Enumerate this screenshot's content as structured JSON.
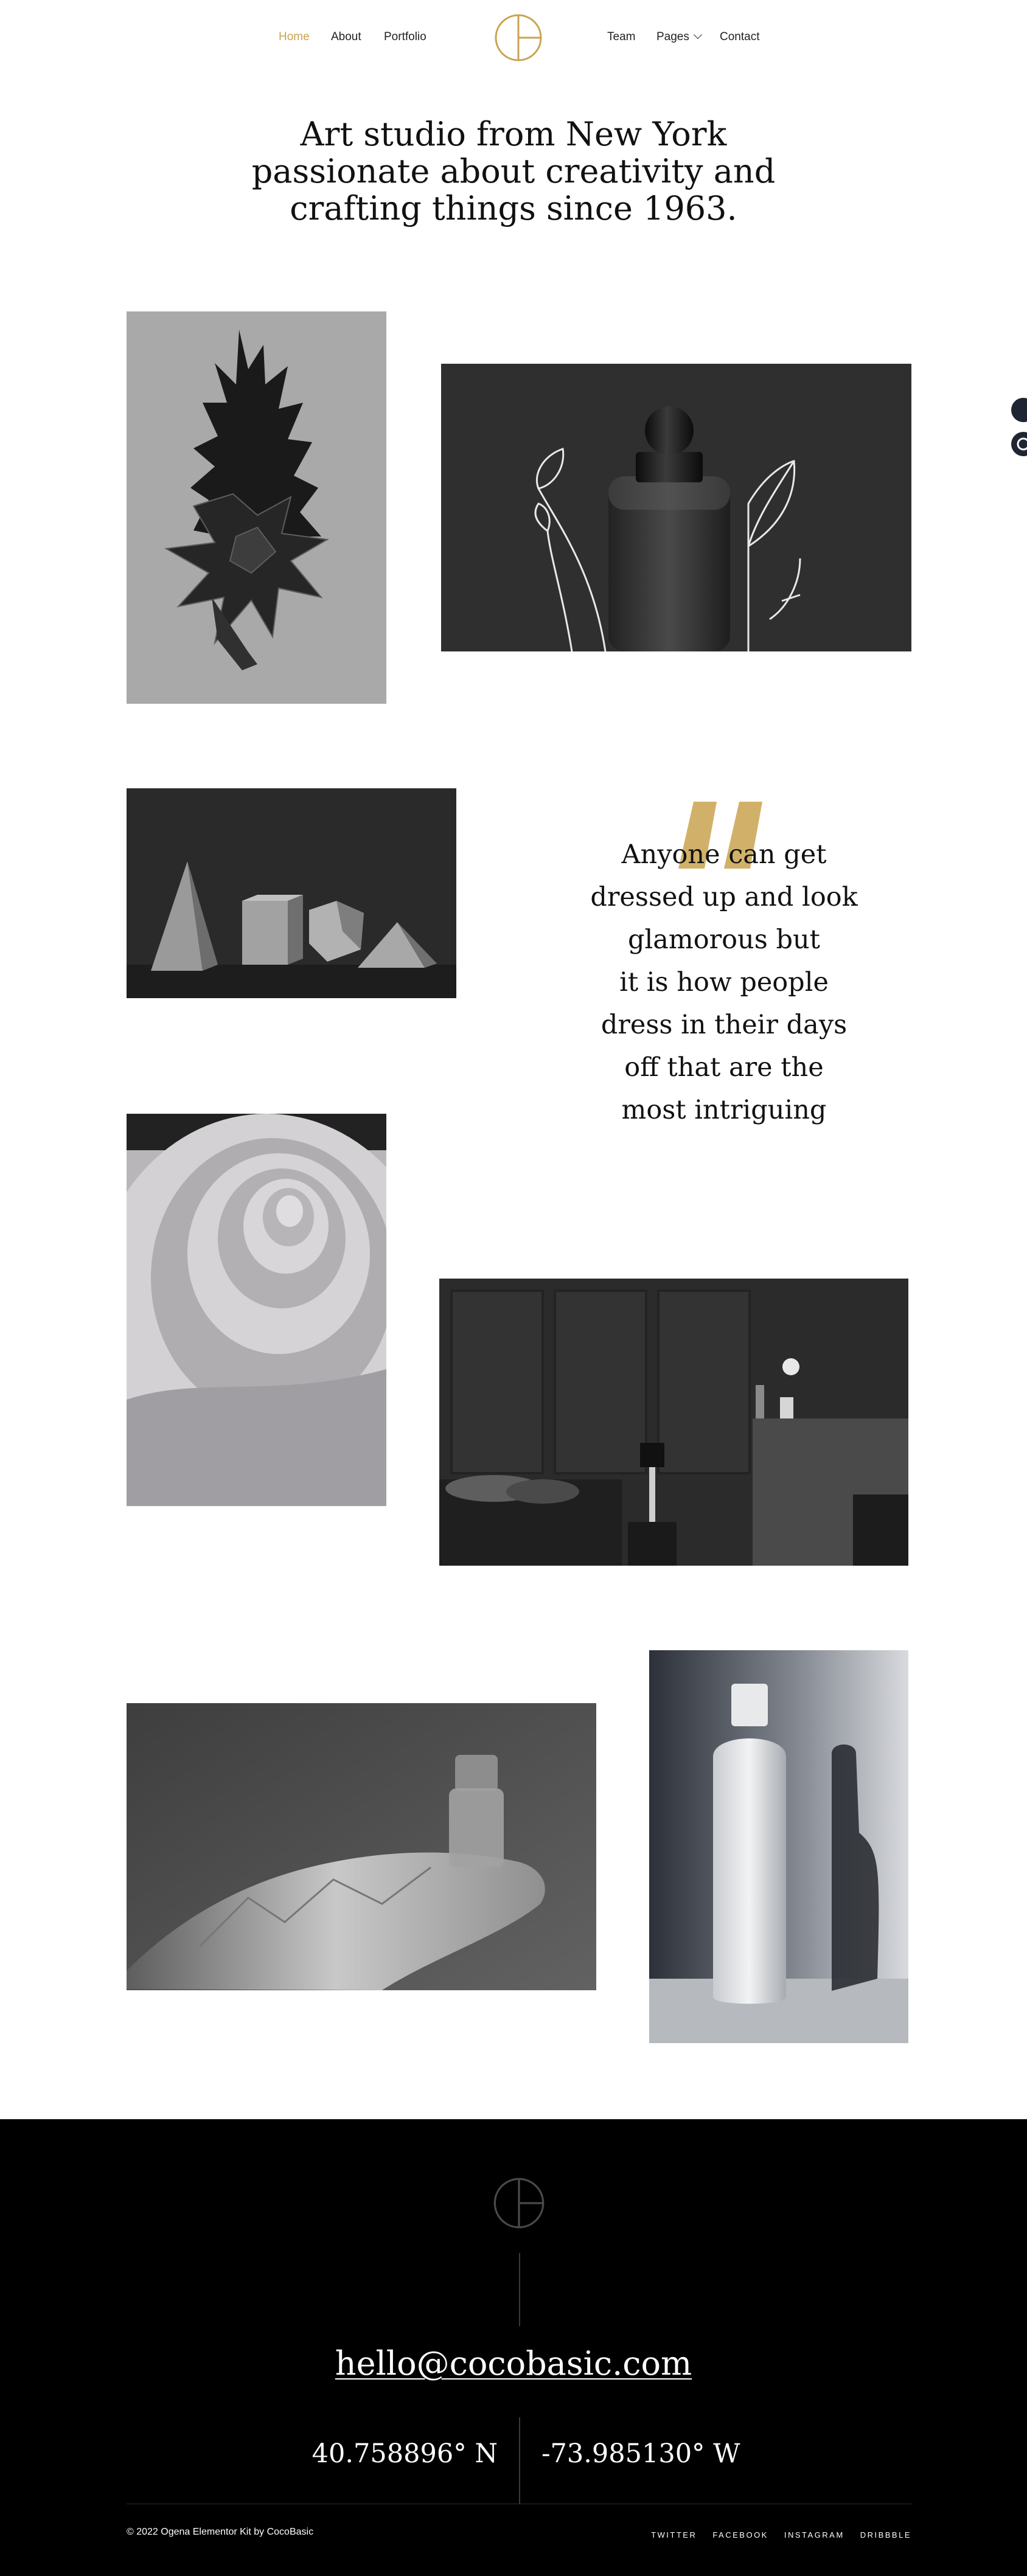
{
  "header": {
    "nav_left": [
      {
        "label": "Home",
        "active": true
      },
      {
        "label": "About",
        "active": false
      },
      {
        "label": "Portfolio",
        "active": false
      }
    ],
    "nav_right": [
      {
        "label": "Team"
      },
      {
        "label": "Pages",
        "has_dropdown": true
      },
      {
        "label": "Contact"
      }
    ],
    "logo_icon": "circle-monogram-logo",
    "accent_color": "#c9a34f"
  },
  "hero": {
    "line1": "Art studio from New York",
    "line2": "passionate about creativity and",
    "line3": "crafting things since 1963."
  },
  "gallery": {
    "images": [
      {
        "subject": "pineapple-silhouette-image"
      },
      {
        "subject": "dropper-bottle-image"
      },
      {
        "subject": "geometric-shapes-image"
      },
      {
        "subject": "spiral-staircase-image"
      },
      {
        "subject": "dark-interior-image"
      },
      {
        "subject": "bottle-on-rock-image"
      },
      {
        "subject": "white-bottle-image"
      }
    ]
  },
  "quote": {
    "line1": "Anyone can get",
    "line2": "dressed up and look",
    "line3": "glamorous but",
    "line4": "it is how people",
    "line5": "dress in their days",
    "line6": "off that are the",
    "line7": "most intriguing"
  },
  "footer": {
    "email": "hello@cocobasic.com",
    "lat": "40.758896° N",
    "lon": "-73.985130° W",
    "copyright": "© 2022 Ogena Elementor Kit by CocoBasic",
    "socials": [
      "TWITTER",
      "FACEBOOK",
      "INSTAGRAM",
      "DRIBBBLE"
    ],
    "background": "#000000"
  }
}
